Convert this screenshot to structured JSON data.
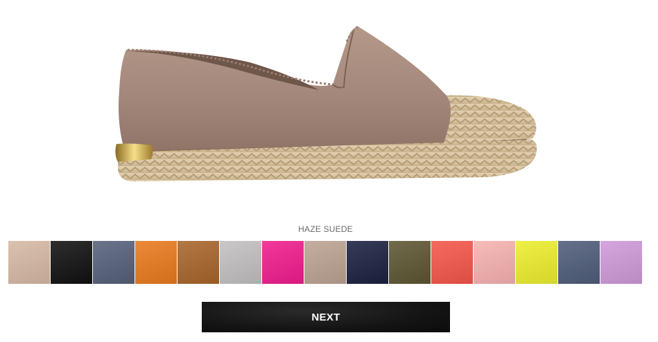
{
  "product": {
    "color_name": "HAZE SUEDE"
  },
  "swatches": [
    {
      "color": "#d6b9a4"
    },
    {
      "color": "#111111"
    },
    {
      "color": "#55617a"
    },
    {
      "color": "#e97a1e"
    },
    {
      "color": "#a8652a"
    },
    {
      "color": "#c2c0c0"
    },
    {
      "color": "#f01d8e"
    },
    {
      "color": "#bca393"
    },
    {
      "color": "#1b2140"
    },
    {
      "color": "#5d5632"
    },
    {
      "color": "#f4564a"
    },
    {
      "color": "#f6b2b0"
    },
    {
      "color": "#ecee2d"
    },
    {
      "color": "#4f5d7a"
    },
    {
      "color": "#cf9ad9"
    }
  ],
  "buttons": {
    "next_label": "NEXT"
  },
  "colors": {
    "upper": "#a88a78",
    "jute": "#d8c4a2",
    "button_bg": "#141414"
  }
}
